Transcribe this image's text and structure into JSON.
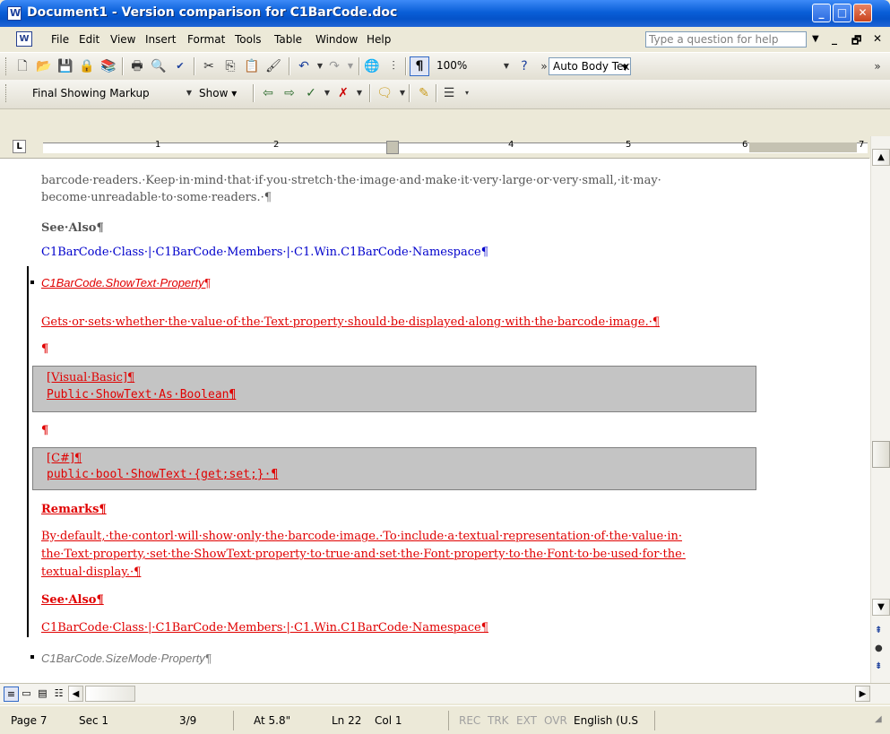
{
  "window": {
    "title": "Document1 - Version comparison for C1BarCode.doc"
  },
  "menu": {
    "items": [
      "File",
      "Edit",
      "View",
      "Insert",
      "Format",
      "Tools",
      "Table",
      "Window",
      "Help"
    ],
    "help_placeholder": "Type a question for help"
  },
  "toolbar_standard": {
    "zoom": "100%",
    "style": "Auto Body Text"
  },
  "toolbar_reviewing": {
    "display_mode": "Final Showing Markup",
    "show_label": "Show"
  },
  "ruler": {
    "numbers": [
      "1",
      "2",
      "4",
      "5",
      "6",
      "7"
    ]
  },
  "document": {
    "intro_line1": "barcode·readers.·Keep·in·mind·that·if·you·stretch·the·image·and·make·it·very·large·or·very·small,·it·may·",
    "intro_line2": "become·unreadable·to·some·readers.·¶",
    "see_also_1": "See·Also¶",
    "links_1": "C1BarCode·Class·|·C1BarCode·Members·|·C1.Win.C1BarCode·Namespace¶",
    "heading_1": "C1BarCode.ShowText·Property¶",
    "desc_1": "Gets·or·sets·whether·the·value·of·the·Text·property·should·be·displayed·along·with·the·barcode·image.·¶",
    "pilcrow": "¶",
    "vb_label": "[Visual·Basic]¶",
    "vb_code": "Public·ShowText·As·Boolean¶",
    "cs_label": "[C#]¶",
    "cs_code": "public·bool·ShowText·{get;set;}·¶",
    "remarks": "Remarks¶",
    "remarks_line1": "By·default,·the·contorl·will·show·only·the·barcode·image.·To·include·a·textual·representation·of·the·value·in·",
    "remarks_line2": "the·Text·property,·set·the·ShowText·property·to·true·and·set·the·Font·property·to·the·Font·to·be·used·for·the·",
    "remarks_line3": "textual·display.·¶",
    "see_also_2": "See·Also¶",
    "links_2": "C1BarCode·Class·|·C1BarCode·Members·|·C1.Win.C1BarCode·Namespace¶",
    "heading_2": "C1BarCode.SizeMode·Property¶"
  },
  "status": {
    "page": "Page 7",
    "sec": "Sec 1",
    "pages": "3/9",
    "at": "At 5.8\"",
    "ln": "Ln 22",
    "col": "Col 1",
    "rec": "REC",
    "trk": "TRK",
    "ext": "EXT",
    "ovr": "OVR",
    "language": "English (U.S"
  },
  "colors": {
    "revision": "#e00000",
    "link": "#0000cc",
    "code_bg": "#c4c4c4"
  }
}
